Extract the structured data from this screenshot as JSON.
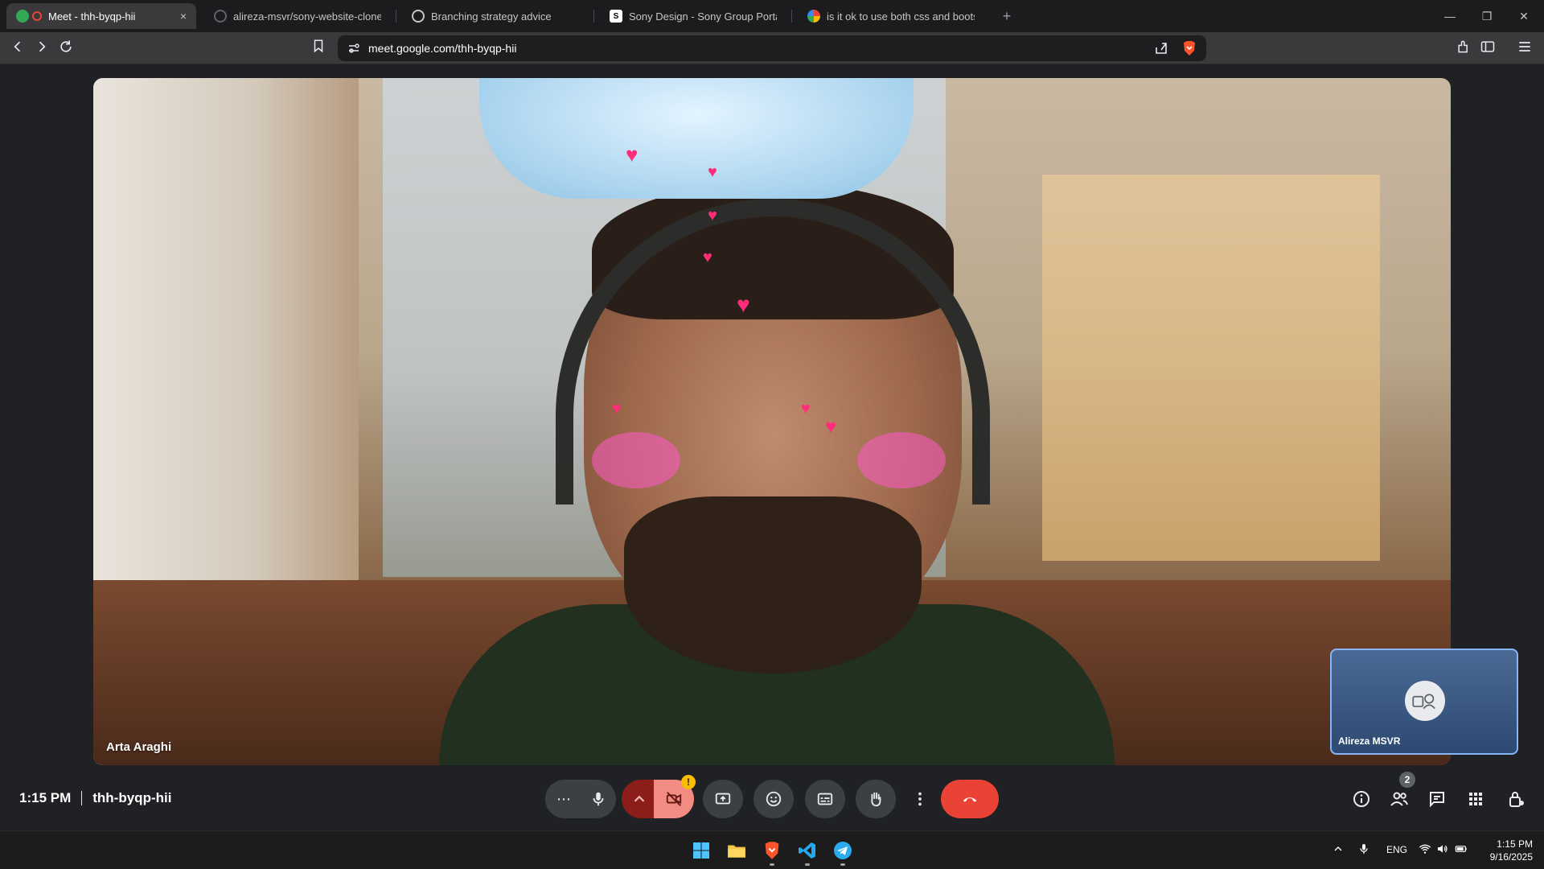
{
  "browser": {
    "tabs": [
      {
        "title": "Meet - thh-byqp-hii",
        "active": true,
        "close": "×"
      },
      {
        "title": "alireza-msvr/sony-website-clone: Co"
      },
      {
        "title": "Branching strategy advice"
      },
      {
        "title": "Sony Design - Sony Group Portal"
      },
      {
        "title": "is it ok to use both css and bootstrap"
      }
    ],
    "new_tab": "+",
    "address": "meet.google.com/thh-byqp-hii"
  },
  "meeting": {
    "participants": {
      "main_name": "Arta Araghi",
      "self_name": "Alireza MSVR"
    },
    "time": "1:15 PM",
    "code": "thh-byqp-hii",
    "camera_warning": "!",
    "people_count": "2",
    "more_options": "⋯"
  },
  "taskbar": {
    "language": "ENG",
    "time": "1:15 PM",
    "date": "9/16/2025"
  },
  "colors": {
    "end_call": "#ea4335",
    "camera_off_bg": "#f28b82",
    "active_tile_border": "#8ab4f8",
    "warn_badge": "#fbbc04"
  }
}
